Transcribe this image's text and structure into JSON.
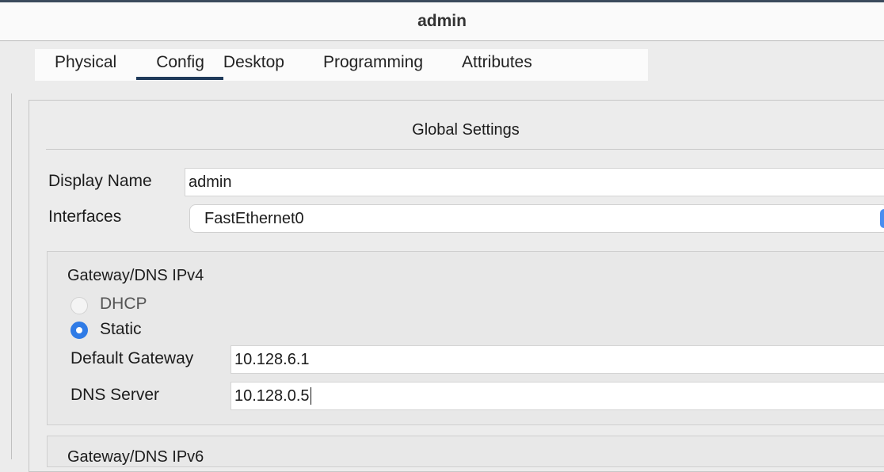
{
  "window": {
    "title": "admin"
  },
  "tabs": [
    {
      "label": "Physical"
    },
    {
      "label": "Config"
    },
    {
      "label": "Desktop"
    },
    {
      "label": "Programming"
    },
    {
      "label": "Attributes"
    }
  ],
  "active_tab": "Config",
  "global": {
    "title": "Global Settings",
    "display_name_label": "Display Name",
    "display_name_value": "admin",
    "interfaces_label": "Interfaces",
    "interfaces_value": "FastEthernet0"
  },
  "gateway_ipv4": {
    "title": "Gateway/DNS IPv4",
    "dhcp_label": "DHCP",
    "static_label": "Static",
    "selected": "Static",
    "default_gateway_label": "Default Gateway",
    "default_gateway_value": "10.128.6.1",
    "dns_server_label": "DNS Server",
    "dns_server_value": "10.128.0.5"
  },
  "gateway_ipv6": {
    "title": "Gateway/DNS IPv6"
  },
  "colors": {
    "accent": "#2f7be6",
    "tab_underline": "#1f3a5a"
  }
}
